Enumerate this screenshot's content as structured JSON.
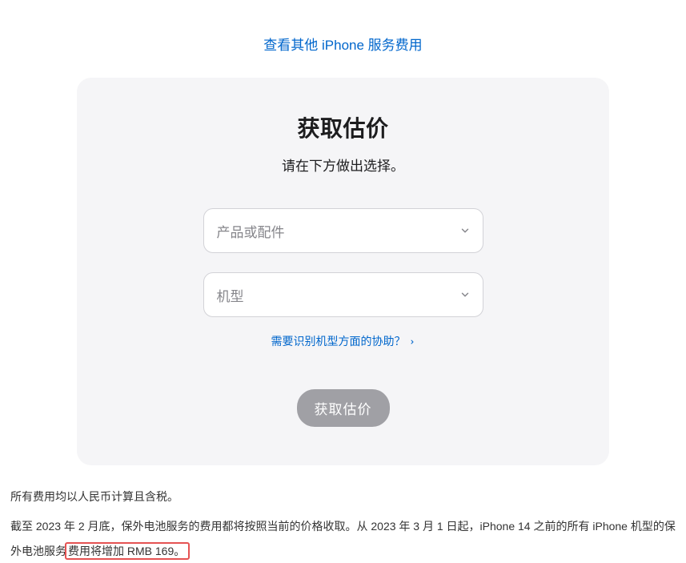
{
  "topLink": {
    "label": "查看其他 iPhone 服务费用"
  },
  "card": {
    "title": "获取估价",
    "subtitle": "请在下方做出选择。",
    "select1": {
      "placeholder": "产品或配件"
    },
    "select2": {
      "placeholder": "机型"
    },
    "helpLink": "需要识别机型方面的协助？",
    "button": "获取估价"
  },
  "footer": {
    "p1": "所有费用均以人民币计算且含税。",
    "p2a": "截至 2023 年 2 月底，保外电池服务的费用都将按照当前的价格收取。从 2023 年 3 月 1 日起，iPhone 14 之前的所有 iPhone 机型的保外电池服务",
    "p2b": "费用将增加 RMB 169。"
  }
}
